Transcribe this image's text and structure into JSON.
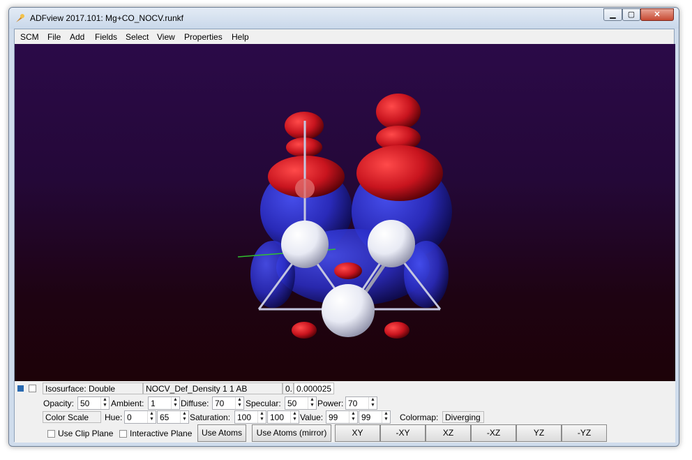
{
  "window": {
    "title": "ADFview 2017.101: Mg+CO_NOCV.runkf",
    "minimize_glyph": "▁",
    "maximize_glyph": "▢",
    "close_glyph": "✕"
  },
  "menu": [
    "SCM",
    "File",
    "Add",
    "Fields",
    "Select",
    "View",
    "Properties",
    "Help"
  ],
  "iso_row": {
    "type": "Isosurface: Double",
    "field": "NOCV_Def_Density 1 1 AB",
    "value_short": "0.",
    "value": "0.000025"
  },
  "props": {
    "opacity_label": "Opacity:",
    "opacity": "50",
    "ambient_label": "Ambient:",
    "ambient": "1",
    "diffuse_label": "Diffuse:",
    "diffuse": "70",
    "specular_label": "Specular:",
    "specular": "50",
    "power_label": "Power:",
    "power": "70"
  },
  "color": {
    "mode": "Color Scale",
    "hue_label": "Hue:",
    "hue1": "0",
    "hue2": "65",
    "sat_label": "Saturation:",
    "sat1": "100",
    "sat2": "100",
    "val_label": "Value:",
    "val1": "99",
    "val2": "99",
    "colormap_label": "Colormap:",
    "colormap": "Diverging"
  },
  "buttons": {
    "clip": "Use Clip Plane",
    "interactive": "Interactive Plane",
    "atoms": "Use Atoms",
    "atoms_mirror": "Use Atoms (mirror)",
    "xy": "XY",
    "mxy": "-XY",
    "xz": "XZ",
    "mxz": "-XZ",
    "yz": "YZ",
    "myz": "-YZ"
  },
  "colors": {
    "positive": "#c8141e",
    "negative": "#2a2ec8",
    "atom": "#e8eaf4"
  }
}
